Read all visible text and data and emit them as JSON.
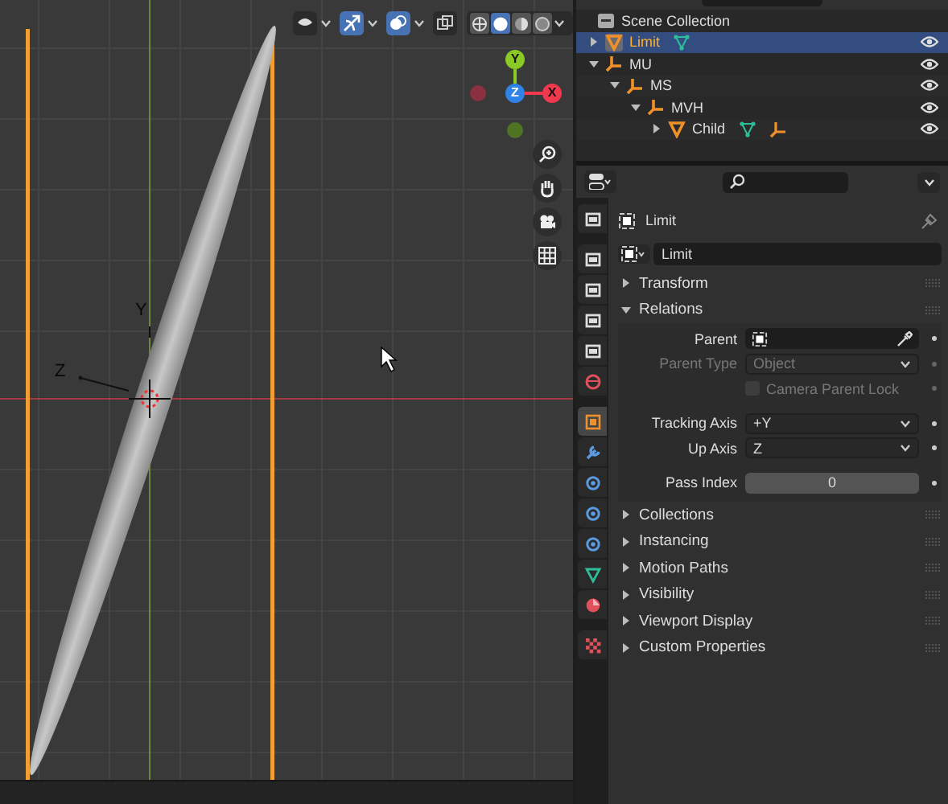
{
  "viewport": {
    "header_toggles": [
      {
        "kind": "visibility",
        "on": false
      },
      {
        "kind": "gizmos",
        "on": true
      },
      {
        "kind": "overlays",
        "on": true
      },
      {
        "kind": "xray",
        "on": false
      }
    ],
    "shading_modes": [
      {
        "kind": "wireframe",
        "selected": false
      },
      {
        "kind": "solid",
        "selected": true
      },
      {
        "kind": "material",
        "selected": false
      },
      {
        "kind": "rendered",
        "selected": false
      }
    ],
    "gizmo": {
      "x_label": "X",
      "y_label": "Y",
      "z_label": "Z"
    },
    "object_axis_labels": [
      "Y",
      "Z"
    ],
    "nav_tools": [
      {
        "kind": "zoom"
      },
      {
        "kind": "pan"
      },
      {
        "kind": "camera"
      },
      {
        "kind": "grid"
      }
    ]
  },
  "outliner": {
    "root": "Scene Collection",
    "items": [
      {
        "name": "Limit",
        "kind": "mesh",
        "selected": true,
        "expanded": false,
        "data_icons": [
          {
            "kind": "mesh"
          }
        ]
      },
      {
        "name": "MU",
        "kind": "empty",
        "selected": false,
        "expanded": true,
        "children": [
          {
            "name": "MS",
            "kind": "empty",
            "selected": false,
            "expanded": true,
            "children": [
              {
                "name": "MVH",
                "kind": "empty",
                "selected": false,
                "expanded": true,
                "children": [
                  {
                    "name": "Child",
                    "kind": "mesh",
                    "selected": false,
                    "expanded": false,
                    "data_icons": [
                      {
                        "kind": "mesh"
                      },
                      {
                        "kind": "empty"
                      }
                    ]
                  }
                ]
              }
            ]
          }
        ]
      }
    ]
  },
  "properties": {
    "tabs": [
      {
        "kind": "tool",
        "selected": false
      },
      {
        "kind": "render",
        "selected": false
      },
      {
        "kind": "output",
        "selected": false
      },
      {
        "kind": "view_layer",
        "selected": false
      },
      {
        "kind": "scene",
        "selected": false
      },
      {
        "kind": "world",
        "selected": false
      },
      {
        "kind": "object",
        "selected": true
      },
      {
        "kind": "modifiers",
        "selected": false
      },
      {
        "kind": "particles",
        "selected": false
      },
      {
        "kind": "physics",
        "selected": false
      },
      {
        "kind": "constraints",
        "selected": false
      },
      {
        "kind": "data",
        "selected": false
      },
      {
        "kind": "material",
        "selected": false
      },
      {
        "kind": "texture",
        "selected": false
      }
    ],
    "object_name": "Limit",
    "datablock_name": "Limit",
    "panels": [
      {
        "title": "Transform",
        "expanded": false
      },
      {
        "title": "Relations",
        "expanded": true,
        "fields": [
          {
            "kind": "object",
            "label": "Parent",
            "disabled": false
          },
          {
            "kind": "dropdown",
            "label": "Parent Type",
            "value": "Object",
            "disabled": true
          },
          {
            "kind": "checkbox",
            "label": "Camera Parent Lock",
            "checked": false,
            "disabled": true
          },
          {
            "kind": "dropdown",
            "label": "Tracking Axis",
            "value": "+Y",
            "disabled": false
          },
          {
            "kind": "dropdown",
            "label": "Up Axis",
            "value": "Z",
            "disabled": false
          },
          {
            "kind": "number",
            "label": "Pass Index",
            "value": "0",
            "disabled": false
          }
        ]
      },
      {
        "title": "Collections",
        "expanded": false
      },
      {
        "title": "Instancing",
        "expanded": false
      },
      {
        "title": "Motion Paths",
        "expanded": false
      },
      {
        "title": "Visibility",
        "expanded": false
      },
      {
        "title": "Viewport Display",
        "expanded": false
      },
      {
        "title": "Custom Properties",
        "expanded": false
      }
    ]
  }
}
